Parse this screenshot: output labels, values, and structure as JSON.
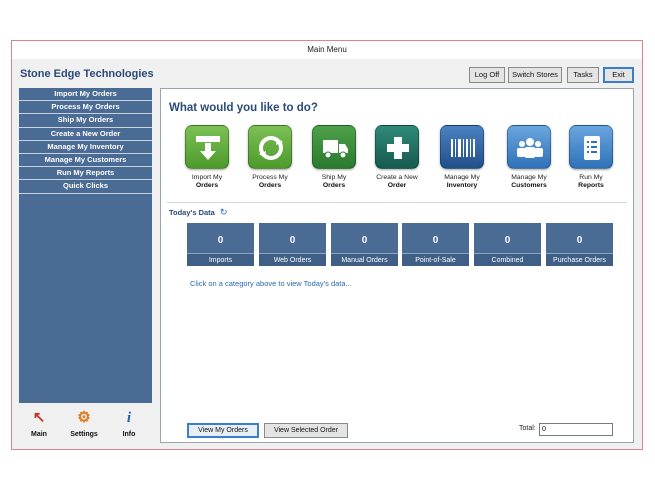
{
  "window": {
    "title": "Main Menu"
  },
  "brand": "Stone Edge Technologies",
  "top_buttons": {
    "logoff": "Log Off",
    "switch": "Switch Stores",
    "tasks": "Tasks",
    "exit": "Exit"
  },
  "sidebar": {
    "items": [
      {
        "label": "Import My Orders"
      },
      {
        "label": "Process My Orders"
      },
      {
        "label": "Ship My Orders"
      },
      {
        "label": "Create a New Order"
      },
      {
        "label": "Manage My Inventory"
      },
      {
        "label": "Manage My Customers"
      },
      {
        "label": "Run My Reports"
      },
      {
        "label": "Quick Clicks"
      }
    ]
  },
  "bottom_nav": {
    "main": "Main",
    "settings": "Settings",
    "info": "Info"
  },
  "main": {
    "heading": "What would you like to do?",
    "actions": [
      {
        "line1": "Import My",
        "line2": "Orders",
        "icon": "import-icon",
        "color": "#5ea43a"
      },
      {
        "line1": "Process My",
        "line2": "Orders",
        "icon": "process-icon",
        "color": "#5ea43a"
      },
      {
        "line1": "Ship My",
        "line2": "Orders",
        "icon": "truck-icon",
        "color": "#2e8a3a"
      },
      {
        "line1": "Create a New",
        "line2": "Order",
        "icon": "plus-icon",
        "color": "#1f6a5f"
      },
      {
        "line1": "Manage My",
        "line2": "Inventory",
        "icon": "barcode-icon",
        "color": "#2a5f9a"
      },
      {
        "line1": "Manage My",
        "line2": "Customers",
        "icon": "people-icon",
        "color": "#3a7fc8"
      },
      {
        "line1": "Run My",
        "line2": "Reports",
        "icon": "report-icon",
        "color": "#3a7fc8"
      }
    ],
    "today_label": "Today's Data",
    "stats": [
      {
        "value": "0",
        "label": "Imports"
      },
      {
        "value": "0",
        "label": "Web Orders"
      },
      {
        "value": "0",
        "label": "Manual Orders"
      },
      {
        "value": "0",
        "label": "Point-of-Sale"
      },
      {
        "value": "0",
        "label": "Combined"
      },
      {
        "value": "0",
        "label": "Purchase Orders"
      }
    ],
    "hint": "Click on a category above to view Today's data...",
    "view_orders": "View My Orders",
    "view_selected": "View Selected Order",
    "total_label": "Total:",
    "total_value": "0"
  }
}
